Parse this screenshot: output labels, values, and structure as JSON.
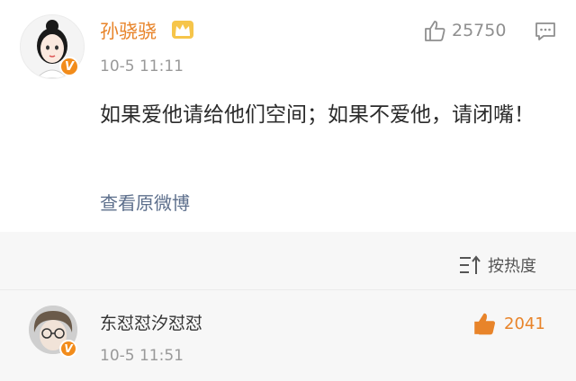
{
  "post": {
    "username": "孙骁骁",
    "time": "10-5 11:11",
    "like_count": "25750",
    "text": "如果爱他请给他们空间；如果不爱他，请闭嘴！",
    "view_original": "查看原微博",
    "verified_mark": "V"
  },
  "comments": {
    "sort_label": "按热度",
    "items": [
      {
        "name": "东怼怼汐怼怼",
        "time": "10-5 11:51",
        "like_count": "2041"
      }
    ]
  },
  "colors": {
    "username": "#e8842a",
    "verified_badge": "#f28c1b",
    "link": "#5d6f8c",
    "comment_like": "#e8842a",
    "comments_bg": "#f7f7f7"
  },
  "icons": [
    "crown-icon",
    "thumbs-up-icon",
    "comment-icon",
    "sort-icon",
    "verified-icon"
  ]
}
